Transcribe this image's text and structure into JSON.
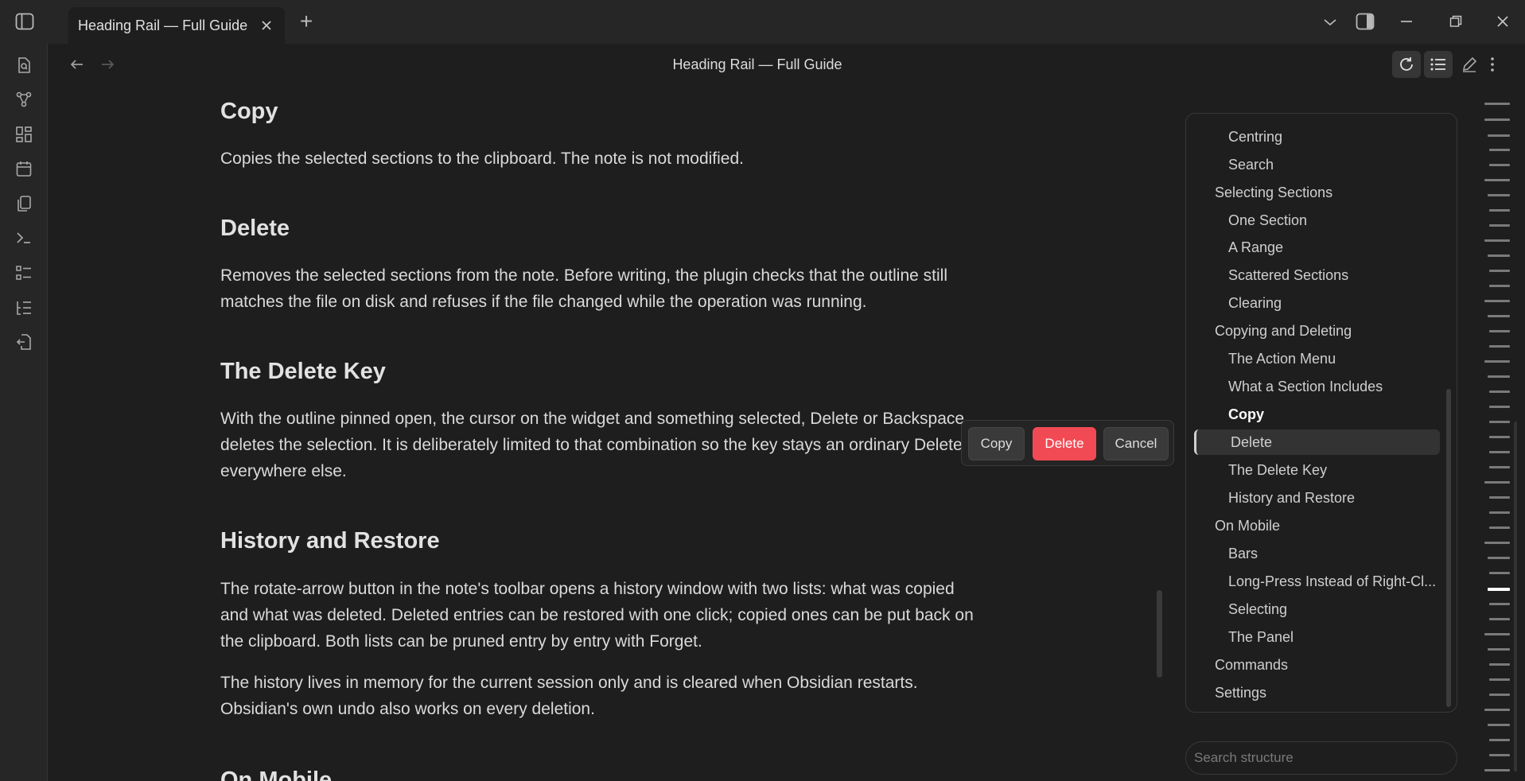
{
  "window": {
    "tab_title": "Heading Rail — Full Guide",
    "new_tab_symbol": "+"
  },
  "view": {
    "title": "Heading Rail — Full Guide"
  },
  "content": {
    "sections": [
      {
        "heading": "Copy",
        "paragraphs": [
          "Copies the selected sections to the clipboard. The note is not modified."
        ]
      },
      {
        "heading": "Delete",
        "paragraphs": [
          "Removes the selected sections from the note. Before writing, the plugin checks that the outline still matches the file on disk and refuses if the file changed while the operation was running."
        ]
      },
      {
        "heading": "The Delete Key",
        "paragraphs": [
          "With the outline pinned open, the cursor on the widget and something selected, Delete or Backspace deletes the selection. It is deliberately limited to that combination so the key stays an ordinary Delete everywhere else."
        ]
      },
      {
        "heading": "History and Restore",
        "paragraphs": [
          "The rotate-arrow button in the note's toolbar opens a history window with two lists: what was copied and what was deleted. Deleted entries can be restored with one click; copied ones can be put back on the clipboard. Both lists can be pruned entry by entry with Forget.",
          "The history lives in memory for the current session only and is cleared when Obsidian restarts. Obsidian's own undo also works on every deletion."
        ]
      },
      {
        "heading": "On Mobile",
        "paragraphs": []
      }
    ]
  },
  "action_menu": {
    "copy_label": "Copy",
    "delete_label": "Delete",
    "cancel_label": "Cancel"
  },
  "outline": {
    "items": [
      {
        "label": "Centring",
        "level": 2
      },
      {
        "label": "Search",
        "level": 2
      },
      {
        "label": "Selecting Sections",
        "level": 1
      },
      {
        "label": "One Section",
        "level": 2
      },
      {
        "label": "A Range",
        "level": 2
      },
      {
        "label": "Scattered Sections",
        "level": 2
      },
      {
        "label": "Clearing",
        "level": 2
      },
      {
        "label": "Copying and Deleting",
        "level": 1
      },
      {
        "label": "The Action Menu",
        "level": 2
      },
      {
        "label": "What a Section Includes",
        "level": 2
      },
      {
        "label": "Copy",
        "level": 2,
        "bold": true
      },
      {
        "label": "Delete",
        "level": 2,
        "selected": true
      },
      {
        "label": "The Delete Key",
        "level": 2
      },
      {
        "label": "History and Restore",
        "level": 2
      },
      {
        "label": "On Mobile",
        "level": 1
      },
      {
        "label": "Bars",
        "level": 2
      },
      {
        "label": "Long-Press Instead of Right-Cl...",
        "level": 2
      },
      {
        "label": "Selecting",
        "level": 2
      },
      {
        "label": "The Panel",
        "level": 2
      },
      {
        "label": "Commands",
        "level": 1
      },
      {
        "label": "Settings",
        "level": 1
      }
    ],
    "search_placeholder": "Search structure"
  },
  "icons": {
    "ribbon": [
      "search-file-icon",
      "graph-icon",
      "canvas-icon",
      "calendar-icon",
      "files-icon",
      "terminal-icon",
      "list-icon",
      "outline-icon",
      "import-icon"
    ],
    "actions": [
      "history-icon",
      "outline-toggle-icon",
      "edit-icon",
      "more-icon"
    ]
  }
}
